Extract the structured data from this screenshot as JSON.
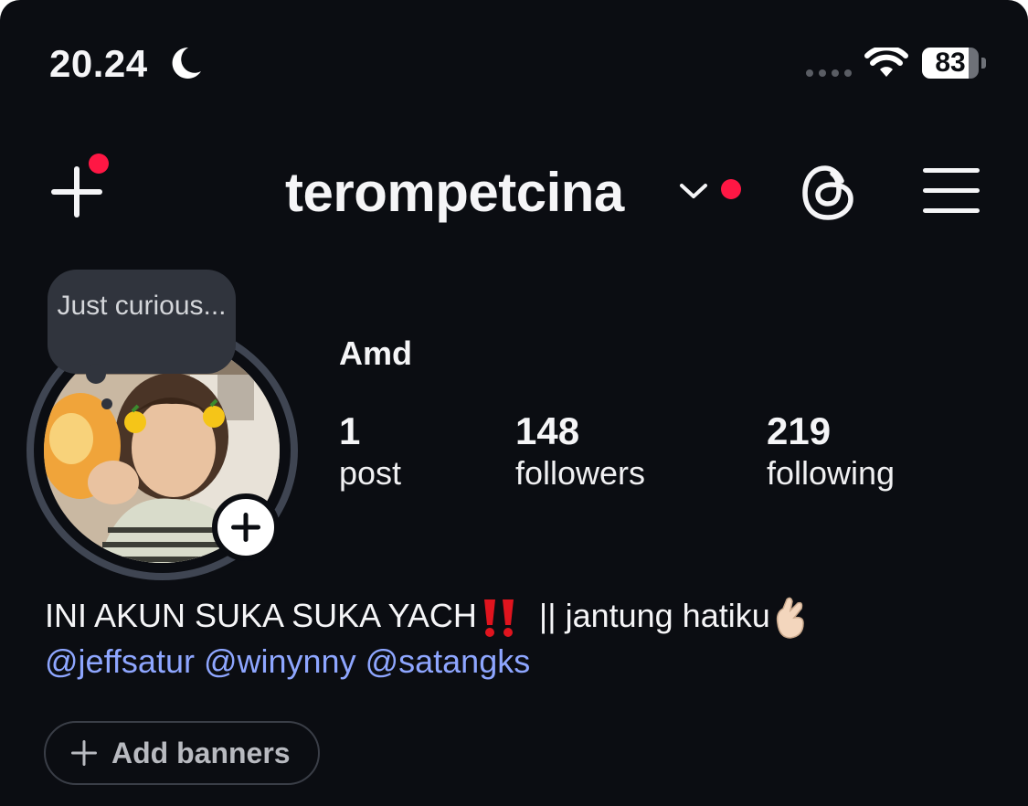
{
  "status_bar": {
    "time": "20.24",
    "battery": "83",
    "battery_level": 0.83,
    "icons": [
      "moon-icon",
      "cellular-signal-icon",
      "wifi-icon",
      "battery-icon"
    ]
  },
  "header": {
    "username": "terompetcina",
    "create_icon": "plus-icon",
    "switch_account_icon": "chevron-down-icon",
    "threads_icon": "threads-icon",
    "menu_icon": "hamburger-menu-icon",
    "notification_color": "#ff1744"
  },
  "profile": {
    "note": "Just curious...",
    "display_name": "Amd",
    "stats": [
      {
        "value": "1",
        "label": "post"
      },
      {
        "value": "148",
        "label": "followers"
      },
      {
        "value": "219",
        "label": "following"
      }
    ]
  },
  "bio": {
    "text": "INI AKUN SUKA SUKA YACH",
    "text_after": "|| jantung hatiku",
    "mentions": [
      "@jeffsatur",
      "@winynny",
      "@satangks"
    ],
    "mention_color": "#8ea6ff",
    "emoji": [
      "double-exclamation-icon",
      "finger-heart-icon"
    ]
  },
  "actions": {
    "add_banners": "Add banners"
  }
}
